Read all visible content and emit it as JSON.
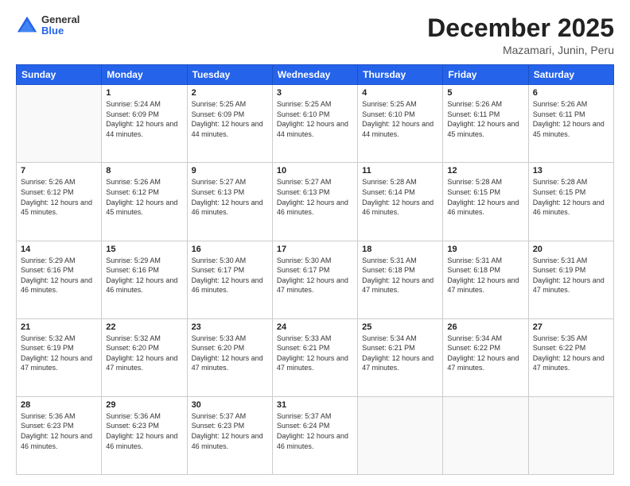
{
  "header": {
    "logo": {
      "general": "General",
      "blue": "Blue"
    },
    "title": "December 2025",
    "location": "Mazamari, Junin, Peru"
  },
  "calendar": {
    "days_of_week": [
      "Sunday",
      "Monday",
      "Tuesday",
      "Wednesday",
      "Thursday",
      "Friday",
      "Saturday"
    ],
    "weeks": [
      [
        {
          "day": "",
          "sunrise": "",
          "sunset": "",
          "daylight": ""
        },
        {
          "day": "1",
          "sunrise": "Sunrise: 5:24 AM",
          "sunset": "Sunset: 6:09 PM",
          "daylight": "Daylight: 12 hours and 44 minutes."
        },
        {
          "day": "2",
          "sunrise": "Sunrise: 5:25 AM",
          "sunset": "Sunset: 6:09 PM",
          "daylight": "Daylight: 12 hours and 44 minutes."
        },
        {
          "day": "3",
          "sunrise": "Sunrise: 5:25 AM",
          "sunset": "Sunset: 6:10 PM",
          "daylight": "Daylight: 12 hours and 44 minutes."
        },
        {
          "day": "4",
          "sunrise": "Sunrise: 5:25 AM",
          "sunset": "Sunset: 6:10 PM",
          "daylight": "Daylight: 12 hours and 44 minutes."
        },
        {
          "day": "5",
          "sunrise": "Sunrise: 5:26 AM",
          "sunset": "Sunset: 6:11 PM",
          "daylight": "Daylight: 12 hours and 45 minutes."
        },
        {
          "day": "6",
          "sunrise": "Sunrise: 5:26 AM",
          "sunset": "Sunset: 6:11 PM",
          "daylight": "Daylight: 12 hours and 45 minutes."
        }
      ],
      [
        {
          "day": "7",
          "sunrise": "Sunrise: 5:26 AM",
          "sunset": "Sunset: 6:12 PM",
          "daylight": "Daylight: 12 hours and 45 minutes."
        },
        {
          "day": "8",
          "sunrise": "Sunrise: 5:26 AM",
          "sunset": "Sunset: 6:12 PM",
          "daylight": "Daylight: 12 hours and 45 minutes."
        },
        {
          "day": "9",
          "sunrise": "Sunrise: 5:27 AM",
          "sunset": "Sunset: 6:13 PM",
          "daylight": "Daylight: 12 hours and 46 minutes."
        },
        {
          "day": "10",
          "sunrise": "Sunrise: 5:27 AM",
          "sunset": "Sunset: 6:13 PM",
          "daylight": "Daylight: 12 hours and 46 minutes."
        },
        {
          "day": "11",
          "sunrise": "Sunrise: 5:28 AM",
          "sunset": "Sunset: 6:14 PM",
          "daylight": "Daylight: 12 hours and 46 minutes."
        },
        {
          "day": "12",
          "sunrise": "Sunrise: 5:28 AM",
          "sunset": "Sunset: 6:15 PM",
          "daylight": "Daylight: 12 hours and 46 minutes."
        },
        {
          "day": "13",
          "sunrise": "Sunrise: 5:28 AM",
          "sunset": "Sunset: 6:15 PM",
          "daylight": "Daylight: 12 hours and 46 minutes."
        }
      ],
      [
        {
          "day": "14",
          "sunrise": "Sunrise: 5:29 AM",
          "sunset": "Sunset: 6:16 PM",
          "daylight": "Daylight: 12 hours and 46 minutes."
        },
        {
          "day": "15",
          "sunrise": "Sunrise: 5:29 AM",
          "sunset": "Sunset: 6:16 PM",
          "daylight": "Daylight: 12 hours and 46 minutes."
        },
        {
          "day": "16",
          "sunrise": "Sunrise: 5:30 AM",
          "sunset": "Sunset: 6:17 PM",
          "daylight": "Daylight: 12 hours and 46 minutes."
        },
        {
          "day": "17",
          "sunrise": "Sunrise: 5:30 AM",
          "sunset": "Sunset: 6:17 PM",
          "daylight": "Daylight: 12 hours and 47 minutes."
        },
        {
          "day": "18",
          "sunrise": "Sunrise: 5:31 AM",
          "sunset": "Sunset: 6:18 PM",
          "daylight": "Daylight: 12 hours and 47 minutes."
        },
        {
          "day": "19",
          "sunrise": "Sunrise: 5:31 AM",
          "sunset": "Sunset: 6:18 PM",
          "daylight": "Daylight: 12 hours and 47 minutes."
        },
        {
          "day": "20",
          "sunrise": "Sunrise: 5:31 AM",
          "sunset": "Sunset: 6:19 PM",
          "daylight": "Daylight: 12 hours and 47 minutes."
        }
      ],
      [
        {
          "day": "21",
          "sunrise": "Sunrise: 5:32 AM",
          "sunset": "Sunset: 6:19 PM",
          "daylight": "Daylight: 12 hours and 47 minutes."
        },
        {
          "day": "22",
          "sunrise": "Sunrise: 5:32 AM",
          "sunset": "Sunset: 6:20 PM",
          "daylight": "Daylight: 12 hours and 47 minutes."
        },
        {
          "day": "23",
          "sunrise": "Sunrise: 5:33 AM",
          "sunset": "Sunset: 6:20 PM",
          "daylight": "Daylight: 12 hours and 47 minutes."
        },
        {
          "day": "24",
          "sunrise": "Sunrise: 5:33 AM",
          "sunset": "Sunset: 6:21 PM",
          "daylight": "Daylight: 12 hours and 47 minutes."
        },
        {
          "day": "25",
          "sunrise": "Sunrise: 5:34 AM",
          "sunset": "Sunset: 6:21 PM",
          "daylight": "Daylight: 12 hours and 47 minutes."
        },
        {
          "day": "26",
          "sunrise": "Sunrise: 5:34 AM",
          "sunset": "Sunset: 6:22 PM",
          "daylight": "Daylight: 12 hours and 47 minutes."
        },
        {
          "day": "27",
          "sunrise": "Sunrise: 5:35 AM",
          "sunset": "Sunset: 6:22 PM",
          "daylight": "Daylight: 12 hours and 47 minutes."
        }
      ],
      [
        {
          "day": "28",
          "sunrise": "Sunrise: 5:36 AM",
          "sunset": "Sunset: 6:23 PM",
          "daylight": "Daylight: 12 hours and 46 minutes."
        },
        {
          "day": "29",
          "sunrise": "Sunrise: 5:36 AM",
          "sunset": "Sunset: 6:23 PM",
          "daylight": "Daylight: 12 hours and 46 minutes."
        },
        {
          "day": "30",
          "sunrise": "Sunrise: 5:37 AM",
          "sunset": "Sunset: 6:23 PM",
          "daylight": "Daylight: 12 hours and 46 minutes."
        },
        {
          "day": "31",
          "sunrise": "Sunrise: 5:37 AM",
          "sunset": "Sunset: 6:24 PM",
          "daylight": "Daylight: 12 hours and 46 minutes."
        },
        {
          "day": "",
          "sunrise": "",
          "sunset": "",
          "daylight": ""
        },
        {
          "day": "",
          "sunrise": "",
          "sunset": "",
          "daylight": ""
        },
        {
          "day": "",
          "sunrise": "",
          "sunset": "",
          "daylight": ""
        }
      ]
    ]
  }
}
